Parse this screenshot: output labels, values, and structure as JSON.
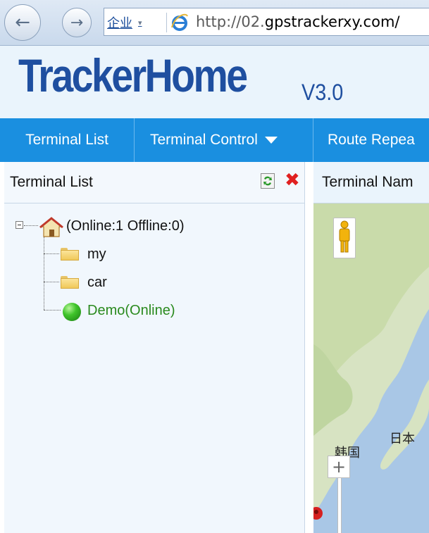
{
  "browser": {
    "zone_label": "企业",
    "zone_caret": "▾",
    "url_prefix": "http://02.",
    "url_host": "gpstrackerxy.com/"
  },
  "header": {
    "logo": "TrackerHome",
    "version": "V3.0"
  },
  "menu": {
    "items": [
      {
        "label": "Terminal List"
      },
      {
        "label": "Terminal Control"
      },
      {
        "label": "Route Repea"
      }
    ]
  },
  "left_panel": {
    "title": "Terminal List",
    "tree": {
      "root_label": "(Online:1   Offline:0)",
      "children": [
        {
          "label": "my",
          "icon": "folder-icon"
        },
        {
          "label": "car",
          "icon": "folder-icon"
        },
        {
          "label": "Demo(Online)",
          "icon": "green-ball-icon",
          "color": "#2a8a1e"
        }
      ]
    }
  },
  "right_panel": {
    "title": "Terminal Nam",
    "map_labels": [
      "日本",
      "韩国"
    ],
    "zoom_in": "+"
  },
  "colors": {
    "menu_bg": "#1a8fe0",
    "logo": "#1f4fa0",
    "online": "#2a8a1e",
    "close": "#e02020"
  }
}
